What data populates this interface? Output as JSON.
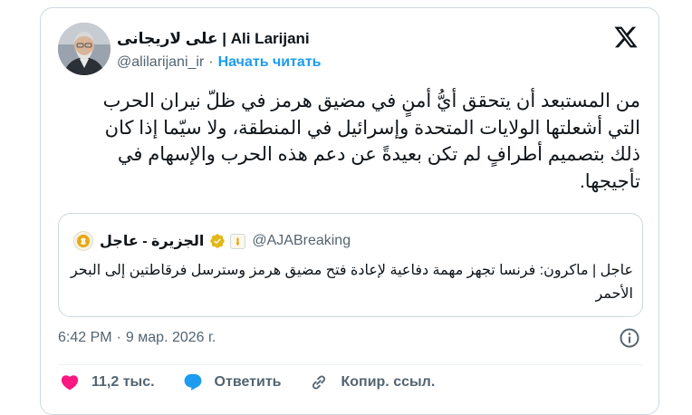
{
  "author": {
    "display_name": "علی لاریجانی | Ali Larijani",
    "handle": "@alilarijani_ir",
    "follow_label": "Начать читать",
    "avatar": "profile-photo"
  },
  "brand": {
    "icon": "x-logo",
    "color": "#0f1419"
  },
  "tweet": {
    "text": "من المستبعد أن يتحقق أيُّ أمنٍ في مضيق هرمز في ظلّ نيران الحرب التي أشعلتها الولايات المتحدة وإسرائيل في المنطقة، ولا سيّما إذا كان ذلك بتصميم أطرافٍ لم تكن بعيدةً عن دعم هذه الحرب والإسهام في تأجيجها."
  },
  "quote": {
    "name": "الجزيرة - عاجل",
    "handle": "@AJABreaking",
    "text": "عاجل | ماكرون: فرنسا تجهز مهمة دفاعية لإعادة فتح مضيق هرمز وسترسل فرقاطتين إلى البحر الأحمر",
    "verified_icon": "gold-verified-badge",
    "affiliate_icon": "affiliate-badge"
  },
  "meta": {
    "time": "6:42 PM",
    "separator": "·",
    "date": "9 мар. 2026 г."
  },
  "actions": {
    "likes": "11,2 тыс.",
    "reply_label": "Ответить",
    "copy_link_label": "Копир. ссыл."
  },
  "colors": {
    "accent": "#1d9bf0",
    "like": "#f91880",
    "muted": "#536471",
    "text": "#0f1419",
    "gold": "#e2b719"
  }
}
